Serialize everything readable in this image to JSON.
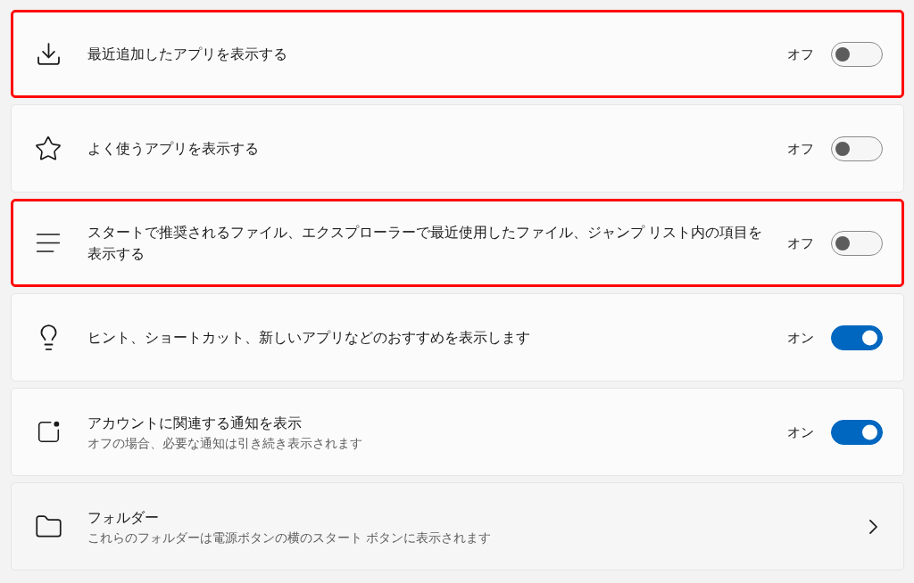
{
  "settings": [
    {
      "kind": "toggle",
      "title": "最近追加したアプリを表示する",
      "status": "オフ",
      "on": false,
      "highlighted": true
    },
    {
      "kind": "toggle",
      "title": "よく使うアプリを表示する",
      "status": "オフ",
      "on": false,
      "highlighted": false
    },
    {
      "kind": "toggle",
      "title": "スタートで推奨されるファイル、エクスプローラーで最近使用したファイル、ジャンプ リスト内の項目を表示する",
      "status": "オフ",
      "on": false,
      "highlighted": true
    },
    {
      "kind": "toggle",
      "title": "ヒント、ショートカット、新しいアプリなどのおすすめを表示します",
      "status": "オン",
      "on": true,
      "highlighted": false
    },
    {
      "kind": "toggle",
      "title": "アカウントに関連する通知を表示",
      "description": "オフの場合、必要な通知は引き続き表示されます",
      "status": "オン",
      "on": true,
      "highlighted": false
    },
    {
      "kind": "link",
      "title": "フォルダー",
      "description": "これらのフォルダーは電源ボタンの横のスタート ボタンに表示されます",
      "highlighted": false
    }
  ]
}
